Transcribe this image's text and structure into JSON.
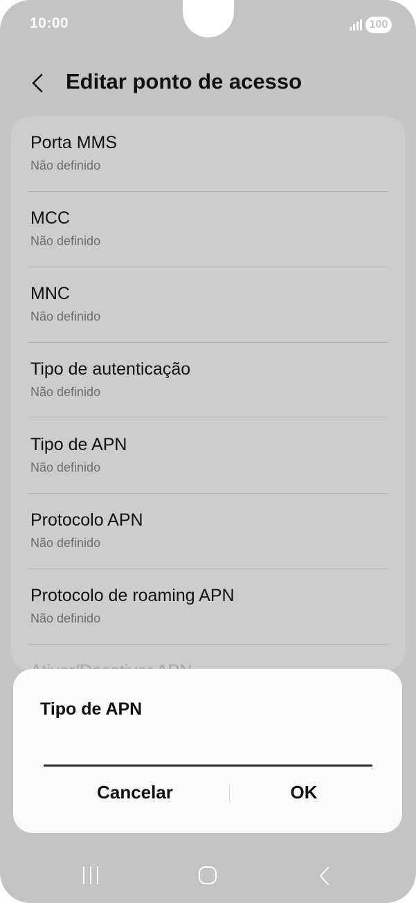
{
  "status_bar": {
    "time": "10:00",
    "battery": "100"
  },
  "header": {
    "title": "Editar ponto de acesso",
    "back_icon": "chevron-left-icon"
  },
  "settings": {
    "items": [
      {
        "label": "Porta MMS",
        "value": "Não definido"
      },
      {
        "label": "MCC",
        "value": "Não definido"
      },
      {
        "label": "MNC",
        "value": "Não definido"
      },
      {
        "label": "Tipo de autenticação",
        "value": "Não definido"
      },
      {
        "label": "Tipo de APN",
        "value": "Não definido"
      },
      {
        "label": "Protocolo APN",
        "value": "Não definido"
      },
      {
        "label": "Protocolo de roaming APN",
        "value": "Não definido"
      },
      {
        "label": "Ativar/Desativar APN",
        "value": ""
      }
    ]
  },
  "dialog": {
    "title": "Tipo de APN",
    "input_value": "",
    "cancel_label": "Cancelar",
    "ok_label": "OK"
  },
  "nav_bar": {
    "recent_icon": "recent-apps-icon",
    "home_icon": "home-icon",
    "back_icon": "back-icon"
  },
  "colors": {
    "background": "#c4c4c6",
    "card": "#cdcdcf",
    "dialog": "#fbfbfd",
    "text": "#111111",
    "subtext": "#6e6e70"
  }
}
